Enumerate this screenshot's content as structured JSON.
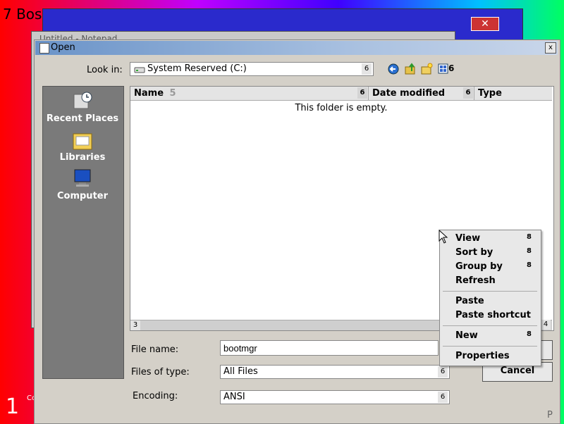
{
  "background": {
    "corner_text": "7 Bos",
    "bottom_number": "1",
    "bottom_small": "Co"
  },
  "back_window": {
    "close_symbol": "✕",
    "title": "Untitled - Notepad"
  },
  "dialog": {
    "title": "Open",
    "close_symbol": "x",
    "look_in": {
      "label": "Look in:",
      "value": "System Reserved (C:)",
      "dropdown_glyph": "6"
    },
    "toolbar_view_glyph": "6",
    "places": [
      {
        "label": "Recent Places",
        "icon": "recent-places-icon"
      },
      {
        "label": "Libraries",
        "icon": "libraries-icon"
      },
      {
        "label": "Computer",
        "icon": "computer-icon"
      }
    ],
    "columns": [
      {
        "label": "Name",
        "sort_glyph": "5",
        "btn_glyph": "6"
      },
      {
        "label": "Date modified",
        "btn_glyph": "6"
      },
      {
        "label": "Type"
      }
    ],
    "empty_message": "This folder is empty.",
    "scroll_left_glyph": "3",
    "scroll_right_glyph": "4",
    "file_name": {
      "label": "File name:",
      "value": "bootmgr"
    },
    "files_of_type": {
      "label": "Files of type:",
      "value": "All Files",
      "dropdown_glyph": "6"
    },
    "encoding": {
      "label": "Encoding:",
      "value": "ANSI",
      "dropdown_glyph": "6"
    },
    "open_button": "",
    "cancel_button": "Cancel",
    "corner_glyph": "P"
  },
  "context_menu": {
    "items": [
      {
        "label": "View",
        "arrow": "8"
      },
      {
        "label": "Sort by",
        "arrow": "8"
      },
      {
        "label": "Group by",
        "arrow": "8"
      },
      {
        "label": "Refresh",
        "arrow": ""
      },
      {
        "label": "Paste",
        "arrow": ""
      },
      {
        "label": "Paste shortcut",
        "arrow": ""
      },
      {
        "label": "New",
        "arrow": "8"
      },
      {
        "label": "Properties",
        "arrow": ""
      }
    ]
  },
  "colors": {
    "dialog_bg": "#d4d0c8",
    "places_bg": "#7a7a7a",
    "titlebar": "#6a93c8"
  }
}
